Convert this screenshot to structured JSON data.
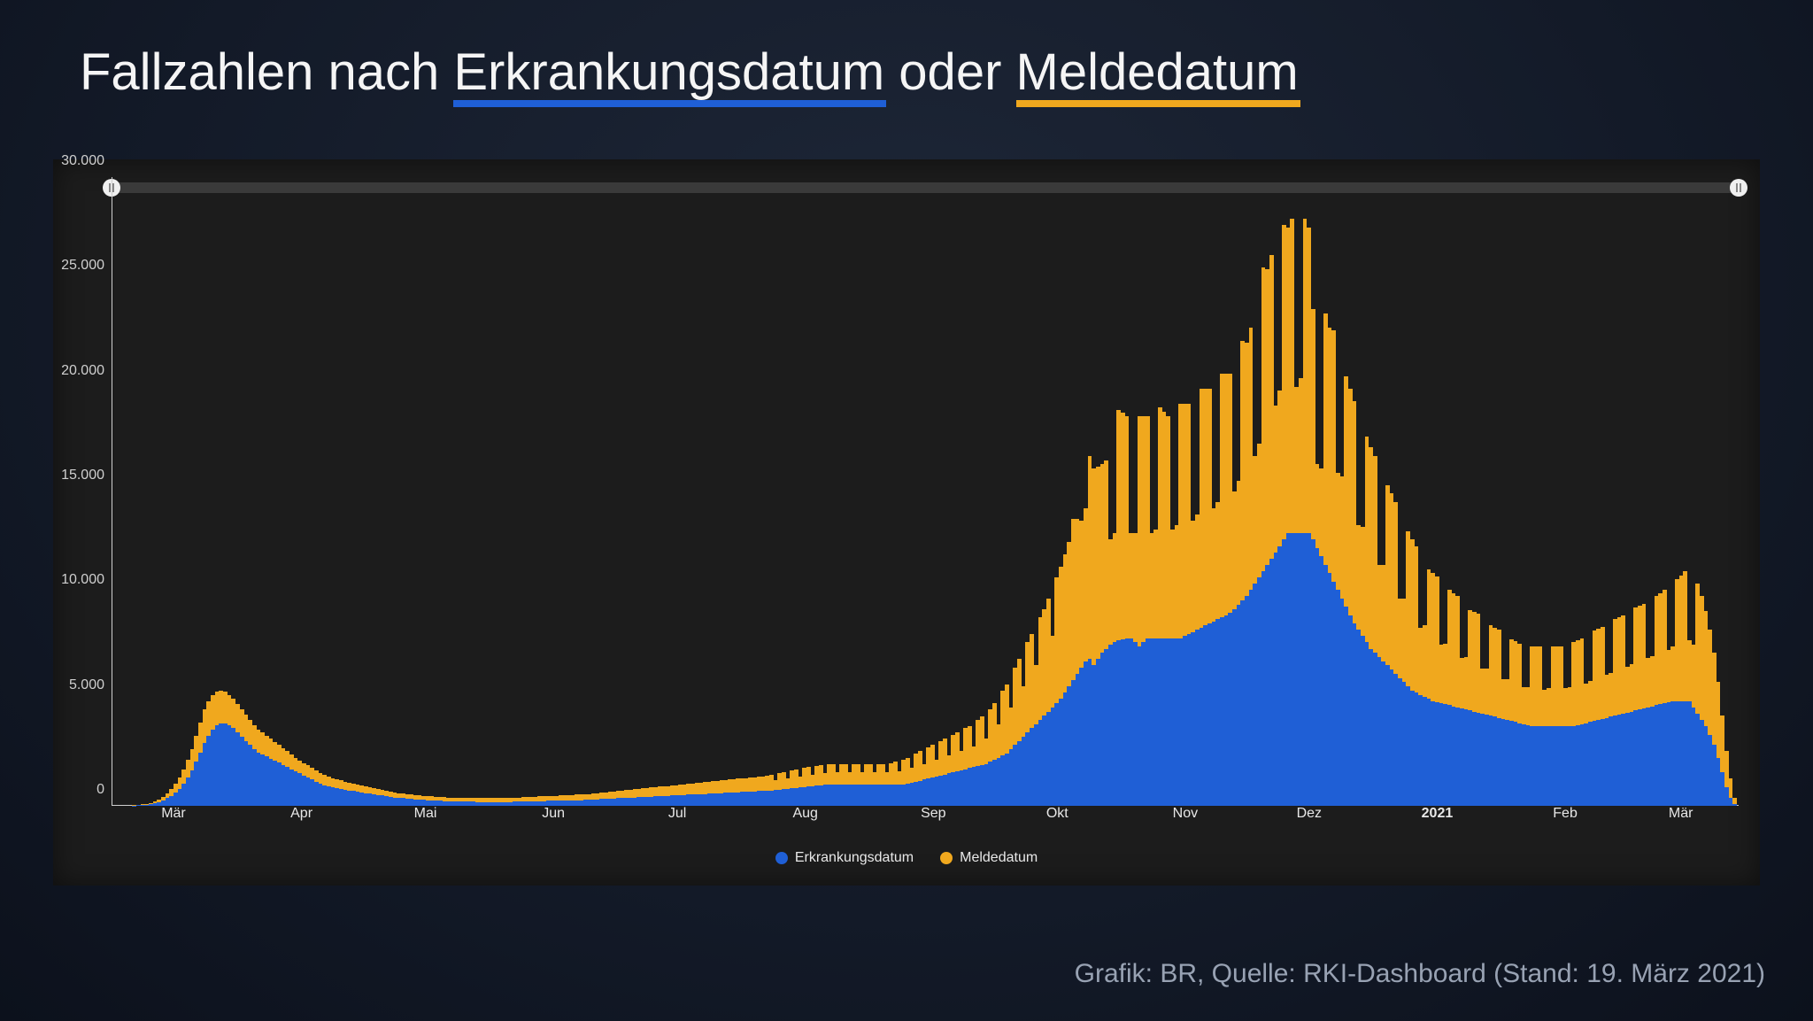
{
  "title": {
    "pre": "Fallzahlen nach ",
    "underline1": "Erkrankungsdatum",
    "mid": " oder ",
    "underline2": "Meldedatum"
  },
  "credit": "Grafik: BR, Quelle: RKI-Dashboard (Stand: 19. März 2021)",
  "legend": {
    "a": "Erkrankungsdatum",
    "b": "Meldedatum"
  },
  "colors": {
    "series_a": "#1f5fd6",
    "series_b": "#f0a81e"
  },
  "chart_data": {
    "type": "bar",
    "stacked": true,
    "ylabel": "",
    "xlabel": "",
    "ylim": [
      0,
      30000
    ],
    "y_ticks": [
      0,
      5000,
      10000,
      15000,
      20000,
      25000,
      30000
    ],
    "y_tick_labels": [
      "0",
      "5.000",
      "10.000",
      "15.000",
      "20.000",
      "25.000",
      "30.000"
    ],
    "x_tick_positions": [
      15,
      46,
      76,
      107,
      137,
      168,
      199,
      229,
      260,
      290,
      321,
      352,
      380
    ],
    "x_tick_labels": [
      "Mär",
      "Apr",
      "Mai",
      "Jun",
      "Jul",
      "Aug",
      "Sep",
      "Okt",
      "Nov",
      "Dez",
      "2021",
      "Feb",
      "Mär"
    ],
    "x_tick_bold": [
      false,
      false,
      false,
      false,
      false,
      false,
      false,
      false,
      false,
      false,
      true,
      false,
      false
    ],
    "n_days": 394,
    "series": [
      {
        "name": "Erkrankungsdatum",
        "color": "#1f5fd6"
      },
      {
        "name": "Meldedatum",
        "color": "#f0a81e"
      }
    ],
    "note": "values below are approximate daily readings estimated from the chart; index 0 ≈ mid-Feb 2020, index 393 ≈ 19 Mar 2021",
    "erkrankung": [
      0,
      0,
      0,
      0,
      0,
      20,
      30,
      40,
      60,
      80,
      120,
      180,
      260,
      360,
      480,
      640,
      820,
      1050,
      1350,
      1700,
      2100,
      2550,
      3000,
      3350,
      3650,
      3850,
      3950,
      3950,
      3850,
      3700,
      3500,
      3300,
      3100,
      2900,
      2700,
      2550,
      2450,
      2350,
      2250,
      2150,
      2050,
      1950,
      1850,
      1750,
      1650,
      1550,
      1450,
      1350,
      1250,
      1150,
      1050,
      980,
      920,
      870,
      830,
      790,
      760,
      730,
      700,
      670,
      640,
      610,
      580,
      550,
      520,
      490,
      460,
      430,
      400,
      380,
      360,
      340,
      320,
      300,
      290,
      280,
      270,
      260,
      250,
      240,
      230,
      225,
      220,
      215,
      210,
      205,
      200,
      195,
      190,
      190,
      190,
      190,
      190,
      190,
      190,
      190,
      190,
      195,
      200,
      205,
      210,
      215,
      220,
      225,
      230,
      235,
      240,
      245,
      250,
      255,
      260,
      265,
      270,
      275,
      280,
      290,
      300,
      310,
      320,
      330,
      340,
      350,
      360,
      370,
      380,
      390,
      400,
      410,
      420,
      430,
      440,
      450,
      460,
      470,
      480,
      490,
      500,
      510,
      520,
      530,
      540,
      550,
      560,
      570,
      580,
      590,
      600,
      610,
      620,
      630,
      640,
      650,
      660,
      670,
      680,
      690,
      700,
      710,
      720,
      740,
      760,
      780,
      800,
      820,
      840,
      860,
      880,
      900,
      920,
      940,
      960,
      980,
      1000,
      1000,
      1000,
      1000,
      1000,
      1000,
      1000,
      1000,
      1000,
      1000,
      1000,
      1000,
      1000,
      1000,
      1000,
      1000,
      1000,
      1000,
      1000,
      1000,
      1050,
      1100,
      1150,
      1200,
      1250,
      1300,
      1350,
      1400,
      1450,
      1500,
      1550,
      1600,
      1650,
      1700,
      1750,
      1800,
      1850,
      1900,
      1950,
      2000,
      2100,
      2200,
      2300,
      2400,
      2500,
      2700,
      2900,
      3100,
      3300,
      3500,
      3700,
      3900,
      4100,
      4300,
      4500,
      4700,
      4900,
      5100,
      5400,
      5700,
      6000,
      6300,
      6600,
      6900,
      7000,
      6700,
      7000,
      7300,
      7500,
      7700,
      7800,
      7900,
      7950,
      7980,
      8000,
      7800,
      7600,
      7800,
      8000,
      8000,
      8000,
      8000,
      8000,
      8000,
      8000,
      8000,
      8000,
      8100,
      8200,
      8300,
      8400,
      8500,
      8600,
      8700,
      8800,
      8900,
      9000,
      9100,
      9200,
      9400,
      9600,
      9800,
      10000,
      10300,
      10600,
      10900,
      11200,
      11500,
      11800,
      12100,
      12400,
      12700,
      13000,
      13000,
      13000,
      13000,
      13000,
      13000,
      12700,
      12300,
      11900,
      11500,
      11100,
      10700,
      10300,
      9900,
      9500,
      9100,
      8700,
      8400,
      8100,
      7800,
      7500,
      7300,
      7100,
      6900,
      6700,
      6500,
      6300,
      6100,
      5900,
      5700,
      5500,
      5400,
      5300,
      5200,
      5100,
      5000,
      4950,
      4900,
      4850,
      4800,
      4750,
      4700,
      4650,
      4600,
      4550,
      4500,
      4450,
      4400,
      4350,
      4300,
      4250,
      4200,
      4150,
      4100,
      4050,
      4000,
      3950,
      3900,
      3850,
      3800,
      3800,
      3800,
      3800,
      3800,
      3800,
      3800,
      3800,
      3800,
      3800,
      3800,
      3850,
      3900,
      3950,
      4000,
      4050,
      4100,
      4150,
      4200,
      4250,
      4300,
      4350,
      4400,
      4450,
      4500,
      4550,
      4600,
      4650,
      4700,
      4750,
      4800,
      4850,
      4900,
      4950,
      5000,
      5000,
      5000,
      5000,
      5000,
      4700,
      4400,
      4100,
      3800,
      3400,
      2900,
      2300,
      1600,
      900,
      400,
      100,
      0
    ],
    "melde": [
      0,
      0,
      0,
      0,
      0,
      10,
      20,
      30,
      40,
      60,
      90,
      130,
      180,
      240,
      320,
      420,
      540,
      680,
      840,
      1020,
      1220,
      1440,
      1600,
      1650,
      1650,
      1600,
      1550,
      1500,
      1450,
      1400,
      1350,
      1300,
      1250,
      1200,
      1150,
      1100,
      1050,
      1000,
      950,
      900,
      850,
      800,
      750,
      700,
      650,
      620,
      600,
      580,
      560,
      540,
      520,
      500,
      480,
      460,
      440,
      420,
      400,
      380,
      360,
      340,
      320,
      300,
      290,
      280,
      270,
      260,
      250,
      240,
      230,
      225,
      220,
      215,
      210,
      205,
      200,
      195,
      190,
      185,
      180,
      178,
      176,
      174,
      172,
      170,
      170,
      170,
      170,
      170,
      172,
      174,
      176,
      178,
      180,
      182,
      184,
      186,
      188,
      190,
      195,
      200,
      205,
      210,
      215,
      220,
      225,
      230,
      235,
      240,
      245,
      250,
      255,
      260,
      265,
      270,
      275,
      280,
      290,
      300,
      310,
      320,
      330,
      340,
      350,
      360,
      370,
      380,
      390,
      400,
      410,
      420,
      430,
      440,
      450,
      460,
      470,
      480,
      490,
      500,
      510,
      520,
      530,
      540,
      550,
      560,
      570,
      580,
      590,
      600,
      610,
      620,
      630,
      640,
      650,
      660,
      670,
      680,
      690,
      700,
      720,
      740,
      450,
      780,
      800,
      480,
      840,
      860,
      500,
      900,
      920,
      550,
      960,
      980,
      580,
      1000,
      1000,
      600,
      1000,
      1000,
      600,
      1000,
      1000,
      600,
      1000,
      1000,
      600,
      1000,
      1000,
      600,
      1050,
      1100,
      650,
      1200,
      1250,
      700,
      1350,
      1400,
      750,
      1500,
      1550,
      800,
      1650,
      1700,
      850,
      1800,
      1850,
      900,
      1950,
      2000,
      1000,
      2200,
      2300,
      1200,
      2500,
      2700,
      1600,
      3100,
      3300,
      2000,
      3700,
      3900,
      2400,
      4300,
      4500,
      2800,
      4900,
      5100,
      5400,
      3400,
      6000,
      6300,
      6600,
      6900,
      7700,
      7400,
      7000,
      7300,
      9700,
      9400,
      9200,
      9000,
      9000,
      5000,
      5200,
      11000,
      10800,
      10600,
      5000,
      5200,
      11000,
      10800,
      10600,
      5000,
      5200,
      11000,
      10800,
      10600,
      5200,
      5400,
      11200,
      11100,
      11000,
      5300,
      5500,
      11400,
      11300,
      11200,
      5400,
      5600,
      11600,
      11500,
      11400,
      5600,
      5900,
      12400,
      12100,
      12500,
      6100,
      6400,
      14500,
      14100,
      14500,
      7000,
      7400,
      15000,
      14600,
      15000,
      7000,
      7400,
      15000,
      14600,
      11000,
      4000,
      4200,
      12000,
      11700,
      12000,
      5600,
      5800,
      11000,
      10800,
      10600,
      5000,
      5200,
      9800,
      9600,
      9400,
      4400,
      4600,
      8600,
      8400,
      8200,
      3800,
      4000,
      7400,
      7200,
      7000,
      3200,
      3400,
      6200,
      6100,
      6000,
      2800,
      2900,
      5500,
      5400,
      5300,
      2400,
      2500,
      4800,
      4750,
      4700,
      2150,
      2200,
      4300,
      4250,
      4200,
      1900,
      1950,
      3900,
      3850,
      3800,
      1750,
      1800,
      3800,
      3800,
      3800,
      1750,
      1800,
      3800,
      3800,
      3800,
      1800,
      1850,
      4000,
      4050,
      4100,
      1900,
      1950,
      4300,
      4350,
      4400,
      2050,
      2100,
      4600,
      4650,
      4700,
      2200,
      2250,
      4900,
      4950,
      5000,
      2350,
      2400,
      5200,
      5300,
      5400,
      2500,
      2600,
      5800,
      6000,
      6200,
      2900,
      3000,
      6200,
      5900,
      5500,
      5000,
      4400,
      3600,
      2700,
      1700,
      900,
      300,
      0
    ]
  }
}
